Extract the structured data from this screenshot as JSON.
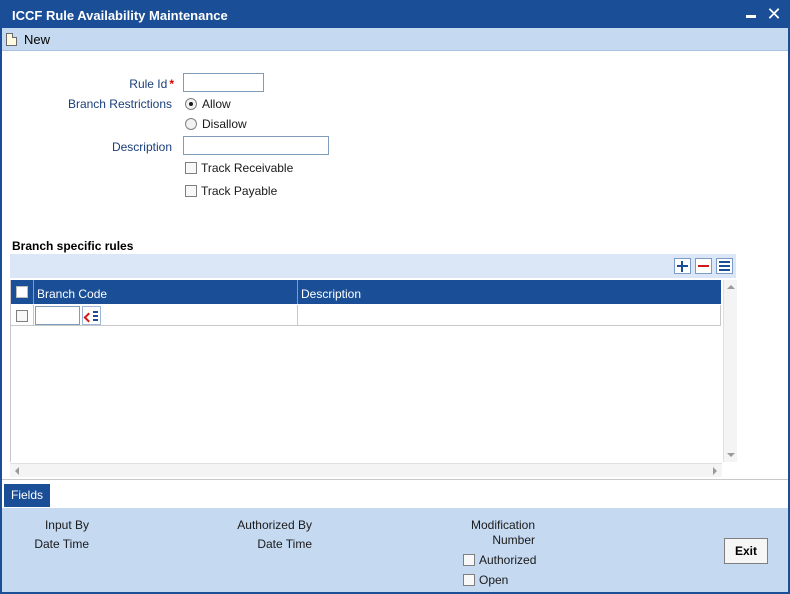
{
  "window": {
    "title": "ICCF Rule Availability Maintenance"
  },
  "toolbar": {
    "new_label": "New"
  },
  "form": {
    "rule_id_label": "Rule Id",
    "rule_id_required": "*",
    "rule_id_value": "",
    "branch_restrictions_label": "Branch Restrictions",
    "branch_restriction_options": [
      {
        "label": "Allow",
        "selected": true
      },
      {
        "label": "Disallow",
        "selected": false
      }
    ],
    "description_label": "Description",
    "description_value": "",
    "track_receivable_label": "Track Receivable",
    "track_receivable_checked": false,
    "track_payable_label": "Track Payable",
    "track_payable_checked": false
  },
  "branch_rules": {
    "section_title": "Branch specific rules",
    "columns": [
      "Branch Code",
      "Description"
    ],
    "rows": [
      {
        "branch_code": "",
        "description": ""
      }
    ]
  },
  "footer": {
    "fields_tab_label": "Fields",
    "input_by_label": "Input By",
    "input_date_time_label": "Date Time",
    "authorized_by_label": "Authorized By",
    "auth_date_time_label": "Date Time",
    "modification_label": "Modification",
    "number_label": "Number",
    "authorized_label": "Authorized",
    "open_label": "Open",
    "exit_label": "Exit"
  },
  "colors": {
    "title_bar": "#1a4e96",
    "toolbar_bg": "#c5d9f1",
    "label_text": "#1a3f7a",
    "required_star": "#dd0000"
  }
}
